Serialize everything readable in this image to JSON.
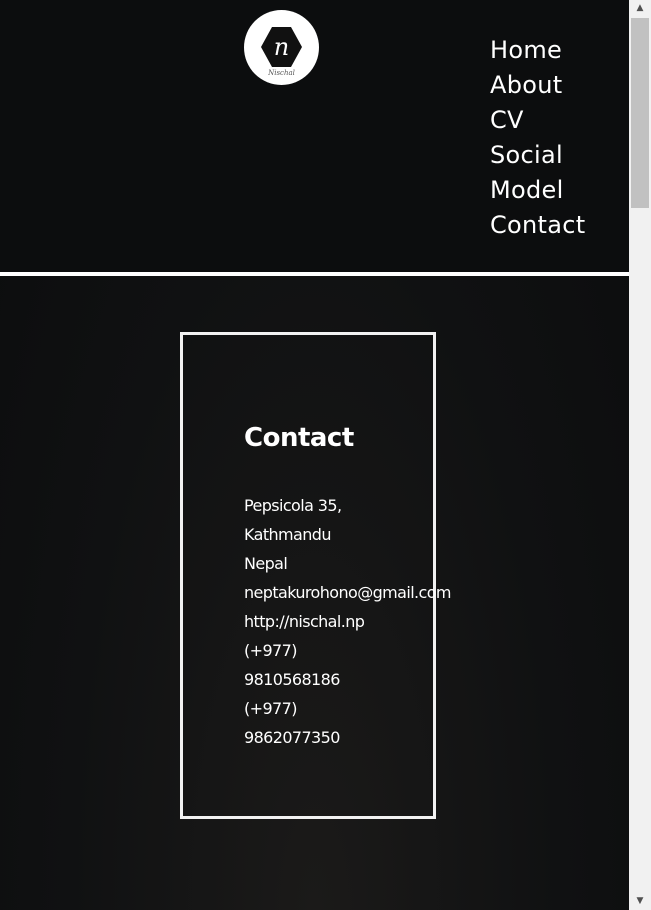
{
  "logo": {
    "letter": "n",
    "caption": "Nischal"
  },
  "nav": {
    "items": [
      "Home",
      "About",
      "CV",
      "Social",
      "Model",
      "Contact"
    ]
  },
  "contact": {
    "title": "Contact",
    "lines": [
      "Pepsicola    35,",
      "Kathmandu",
      "Nepal",
      "neptakurohono@gmail.com",
      "http://nischal.np",
      "(+977)",
      "9810568186",
      "(+977)",
      "9862077350"
    ]
  },
  "scrollbar": {
    "up_glyph": "▲",
    "down_glyph": "▼"
  },
  "colors": {
    "background": "#0d0e0f",
    "text": "#ffffff",
    "divider": "#ffffff"
  }
}
